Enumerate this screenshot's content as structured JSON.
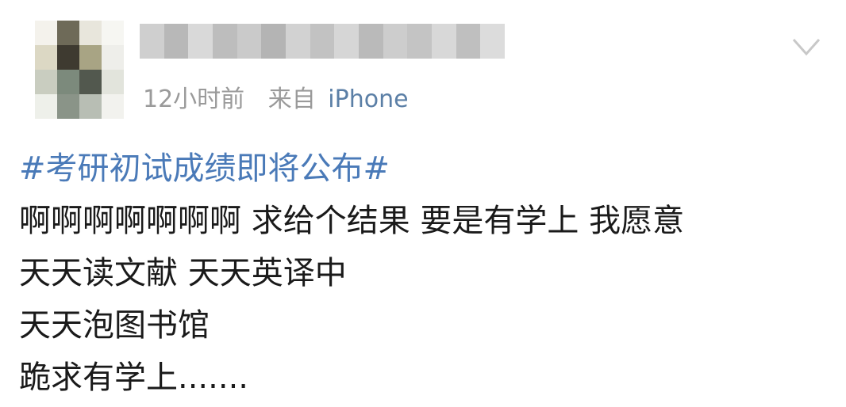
{
  "post": {
    "time": "12小时前",
    "from_label": "来自",
    "device": "iPhone",
    "hashtag": "#考研初试成绩即将公布#",
    "lines": [
      "啊啊啊啊啊啊啊 求给个结果 要是有学上 我愿意",
      "天天读文献 天天英译中",
      "天天泡图书馆",
      "跪求有学上......."
    ]
  },
  "icons": {
    "menu": "chevron-down-icon"
  },
  "colors": {
    "link": "#4a7ab8",
    "meta": "#9a9a9a",
    "text": "#1a1a1a"
  }
}
